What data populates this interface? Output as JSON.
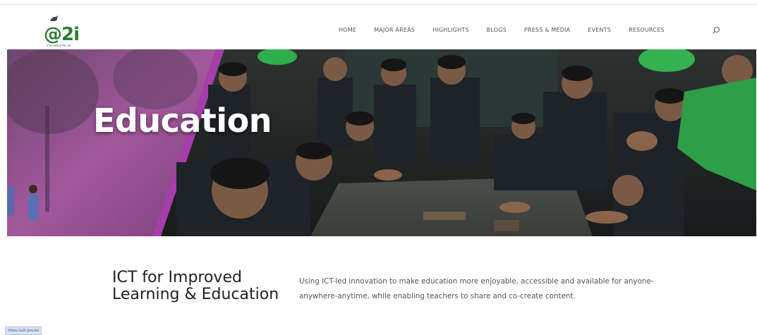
{
  "header": {
    "logo_text_prefix": "@",
    "logo_text": "2i",
    "logo_tagline": "innovation for all",
    "nav": [
      "HOME",
      "MAJOR AREAS",
      "HIGHLIGHTS",
      "BLOGS",
      "PRESS & MEDIA",
      "EVENTS",
      "RESOURCES"
    ]
  },
  "hero": {
    "title": "Education"
  },
  "section": {
    "heading": "ICT for Improved Learning & Education",
    "description": "Using ICT-led innovation to make education more enjoyable, accessible and available for anyone-anywhere-anytime, while enabling teachers to share and co-create content."
  },
  "status_bar": {
    "url": "https://a2i.gov.bd"
  },
  "colors": {
    "brand_red": "#d2232a",
    "brand_green": "#2e7d32",
    "hero_purple": "#8e3a8e",
    "jacket_green": "#2f9e48"
  }
}
